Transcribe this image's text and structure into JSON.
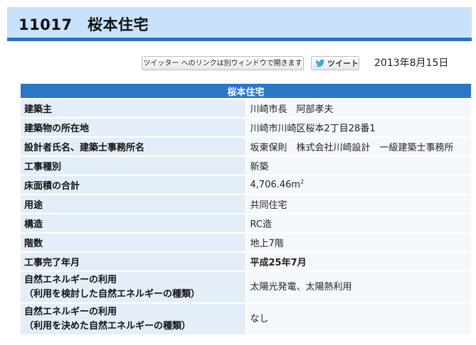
{
  "header": {
    "title": "11017　桜本住宅"
  },
  "share": {
    "twitter_link_label": "ツイッター へのリンクは別ウィンドウで開きます",
    "tweet_label": "ツイート",
    "date": "2013年8月15日"
  },
  "table": {
    "heading": "桜本住宅",
    "rows": [
      {
        "key": "建築主",
        "value": "川崎市長　阿部孝夫"
      },
      {
        "key": "建築物の所在地",
        "value": "川崎市川崎区桜本2丁目28番1"
      },
      {
        "key": "設計者氏名、建築士事務所名",
        "value": "坂東保則　株式会社川崎設計　一級建築士事務所"
      },
      {
        "key": "工事種別",
        "value": "新築"
      },
      {
        "key": "床面積の合計",
        "value": "4,706.46m",
        "value_sup": "2"
      },
      {
        "key": "用途",
        "value": "共同住宅"
      },
      {
        "key": "構造",
        "value": "RC造"
      },
      {
        "key": "階数",
        "value": "地上7階"
      },
      {
        "key": "工事完了年月",
        "value": "平成25年7月"
      },
      {
        "key_line1": "自然エネルギーの利用",
        "key_line2": "（利用を検討した自然エネルギーの種類）",
        "value": "太陽光発電、太陽熱利用"
      },
      {
        "key_line1": "自然エネルギーの利用",
        "key_line2": "（利用を決めた自然エネルギーの種類）",
        "value": "なし"
      }
    ]
  },
  "colors": {
    "title_bg": "#c9e2fb",
    "accent": "#2a72c9",
    "header_bg": "#2b76c9",
    "key_bg": "#e3eef8",
    "value_bg": "#f4f8fc",
    "highlight": "#b30000"
  },
  "icons": {
    "tweet": "twitter-bird-icon"
  }
}
